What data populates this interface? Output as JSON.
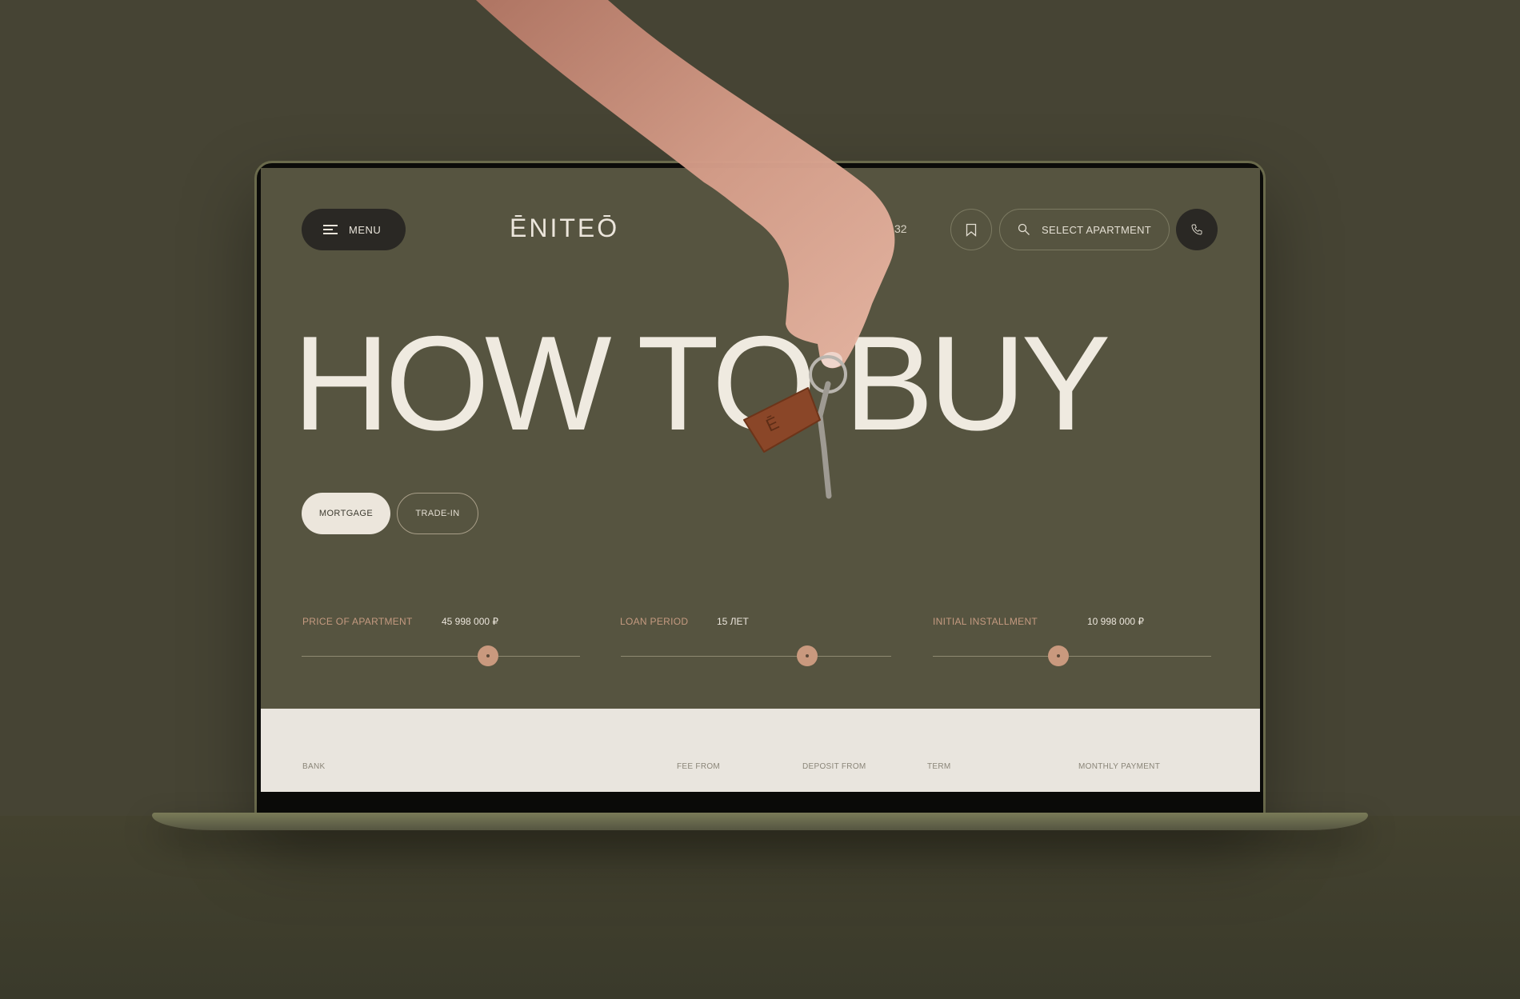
{
  "header": {
    "menu_label": "MENU",
    "logo_text": "ĒNITEŌ",
    "phone_fragment": "32",
    "select_label": "SELECT APARTMENT"
  },
  "hero": {
    "title": "HOW TO BUY"
  },
  "tabs": [
    {
      "label": "MORTGAGE",
      "active": true
    },
    {
      "label": "TRADE-IN",
      "active": false
    }
  ],
  "sliders": [
    {
      "label": "PRICE OF APARTMENT",
      "value": "45 998 000 ₽",
      "fraction": 0.67
    },
    {
      "label": "LOAN PERIOD",
      "value": "15 ЛЕТ",
      "fraction": 0.69
    },
    {
      "label": "INITIAL INSTALLMENT",
      "value": "10 998 000 ₽",
      "fraction": 0.45
    }
  ],
  "table": {
    "columns": [
      "BANK",
      "FEE FROM",
      "DEPOSIT FROM",
      "TERM",
      "MONTHLY PAYMENT"
    ]
  },
  "colors": {
    "background": "#464434",
    "screen": "#565440",
    "accent": "#c9997e",
    "text_light": "#ece6dc",
    "table_bg": "#e9e5de"
  },
  "icons": [
    "menu-icon",
    "bookmark-icon",
    "search-icon",
    "phone-icon"
  ]
}
